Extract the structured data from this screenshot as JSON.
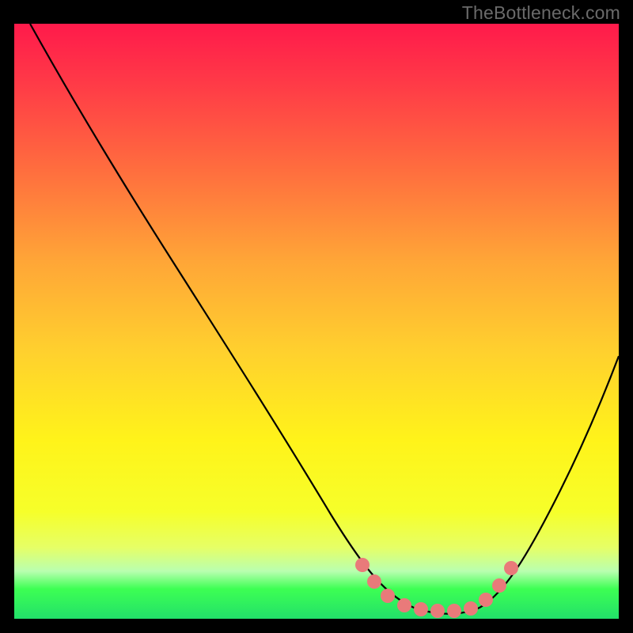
{
  "watermark": "TheBottleneck.com",
  "chart_data": {
    "type": "line",
    "title": "",
    "xlabel": "",
    "ylabel": "",
    "xlim": [
      0,
      100
    ],
    "ylim": [
      0,
      100
    ],
    "grid": false,
    "legend": false,
    "series": [
      {
        "name": "bottleneck-curve",
        "color": "#000000",
        "x": [
          2,
          10,
          20,
          30,
          40,
          50,
          54,
          58,
          62,
          66,
          70,
          74,
          78,
          82,
          86,
          90,
          94,
          98,
          100
        ],
        "y": [
          100,
          86,
          70,
          55,
          39,
          23,
          17,
          10,
          5,
          2,
          0.7,
          0.7,
          1.5,
          5,
          12,
          22,
          33,
          45,
          52
        ]
      }
    ],
    "markers": {
      "name": "valley-points",
      "color": "#e97a7a",
      "x": [
        57,
        59,
        62,
        65,
        68,
        71,
        74,
        77,
        79,
        81,
        83
      ],
      "y": [
        10,
        6,
        3,
        1.6,
        1,
        0.7,
        0.7,
        1.4,
        3.5,
        7,
        12
      ]
    },
    "background_gradient": {
      "stops": [
        {
          "pos": 0,
          "color": "#ff1a4b"
        },
        {
          "pos": 25,
          "color": "#ff6f3e"
        },
        {
          "pos": 55,
          "color": "#ffd02e"
        },
        {
          "pos": 82,
          "color": "#f6ff2a"
        },
        {
          "pos": 95,
          "color": "#3dff53"
        },
        {
          "pos": 100,
          "color": "#22e06a"
        }
      ]
    }
  }
}
